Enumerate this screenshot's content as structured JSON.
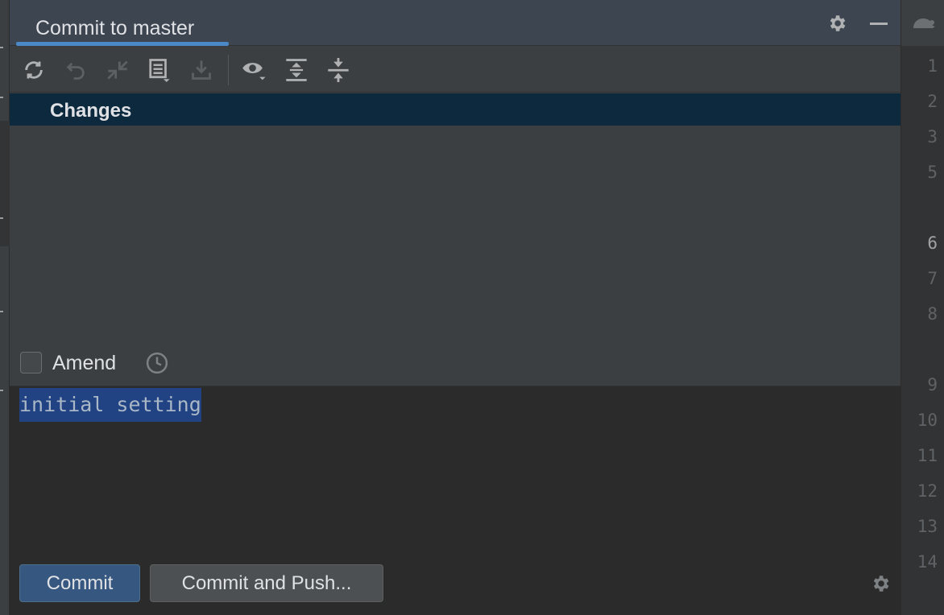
{
  "window": {
    "tab_title": "Commit to master"
  },
  "header": {
    "settings_icon": "gear-icon",
    "minimize_icon": "minimize-icon"
  },
  "toolbar": {
    "items": [
      {
        "name": "refresh-icon",
        "enabled": true
      },
      {
        "name": "rollback-icon",
        "enabled": false
      },
      {
        "name": "diff-icon",
        "enabled": false
      },
      {
        "name": "changelist-icon",
        "enabled": true
      },
      {
        "name": "shelve-icon",
        "enabled": false
      },
      {
        "name": "view-options-icon",
        "enabled": true
      },
      {
        "name": "expand-all-icon",
        "enabled": true
      },
      {
        "name": "collapse-all-icon",
        "enabled": true
      }
    ]
  },
  "changes": {
    "group_label": "Changes"
  },
  "amend": {
    "label": "Amend",
    "checked": false
  },
  "message": {
    "text": "initial setting"
  },
  "buttons": {
    "commit": "Commit",
    "commit_and_push": "Commit and Push..."
  },
  "gutter": {
    "line_numbers": [
      "1",
      "2",
      "3",
      "5",
      "6",
      "7",
      "8",
      "9",
      "10",
      "11",
      "12",
      "13",
      "14"
    ],
    "current_line": "6"
  },
  "colors": {
    "accent": "#4a88c7",
    "selection": "#214283",
    "selected_row": "#0d293e",
    "primary_button": "#365880"
  }
}
